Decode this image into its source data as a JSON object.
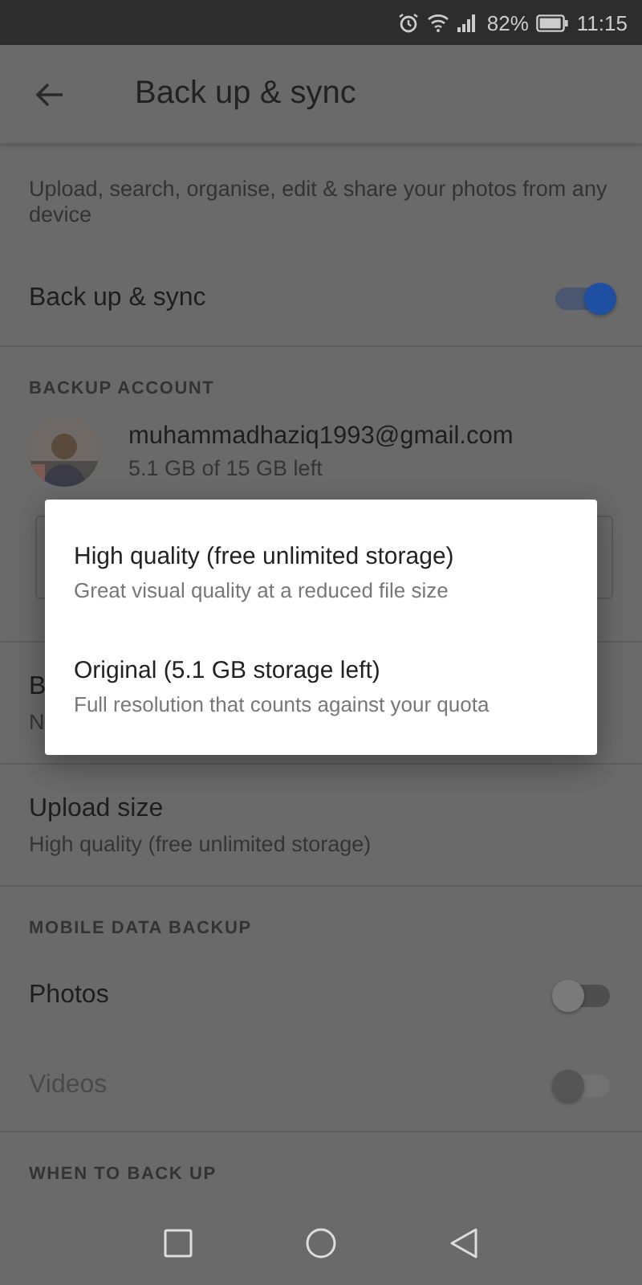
{
  "status_bar": {
    "battery": "82%",
    "time": "11:15"
  },
  "app_bar": {
    "title": "Back up & sync"
  },
  "description": "Upload, search, organise, edit & share your photos from any device",
  "sync": {
    "label": "Back up & sync",
    "on": true
  },
  "backup_account": {
    "header": "BACKUP ACCOUNT",
    "email": "muhammadhaziq1993@gmail.com",
    "storage": "5.1 GB of 15 GB left"
  },
  "covered_row": {
    "title": "B",
    "subtitle": "N"
  },
  "upload_size": {
    "title": "Upload size",
    "value": "High quality (free unlimited storage)"
  },
  "mobile_data": {
    "header": "MOBILE DATA BACKUP",
    "items": [
      {
        "label": "Photos",
        "on": false,
        "disabled": false
      },
      {
        "label": "Videos",
        "on": false,
        "disabled": true
      }
    ]
  },
  "when_header": "WHEN TO BACK UP",
  "dialog": {
    "options": [
      {
        "title": "High quality (free unlimited storage)",
        "subtitle": "Great visual quality at a reduced file size"
      },
      {
        "title": "Original (5.1 GB storage left)",
        "subtitle": "Full resolution that counts against your quota"
      }
    ]
  }
}
